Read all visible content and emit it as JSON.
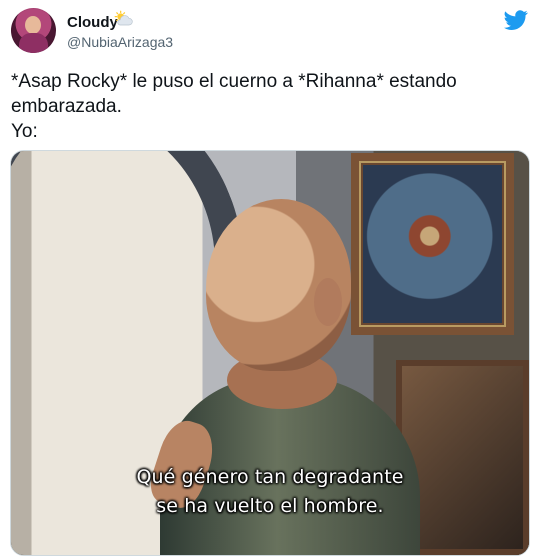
{
  "tweet": {
    "display_name": "Cloudy",
    "username": "@NubiaArizaga3",
    "text_lines": [
      "*Asap Rocky* le puso el cuerno a *Rihanna* estando",
      "embarazada.",
      "Yo:"
    ],
    "name_icon": "sun-behind-cloud-icon",
    "platform_icon": "twitter-bird-icon",
    "accent_color": "#1d9bf0"
  },
  "media": {
    "subtitle_lines": [
      "Qué género tan degradante",
      "se ha vuelto el hombre."
    ]
  }
}
